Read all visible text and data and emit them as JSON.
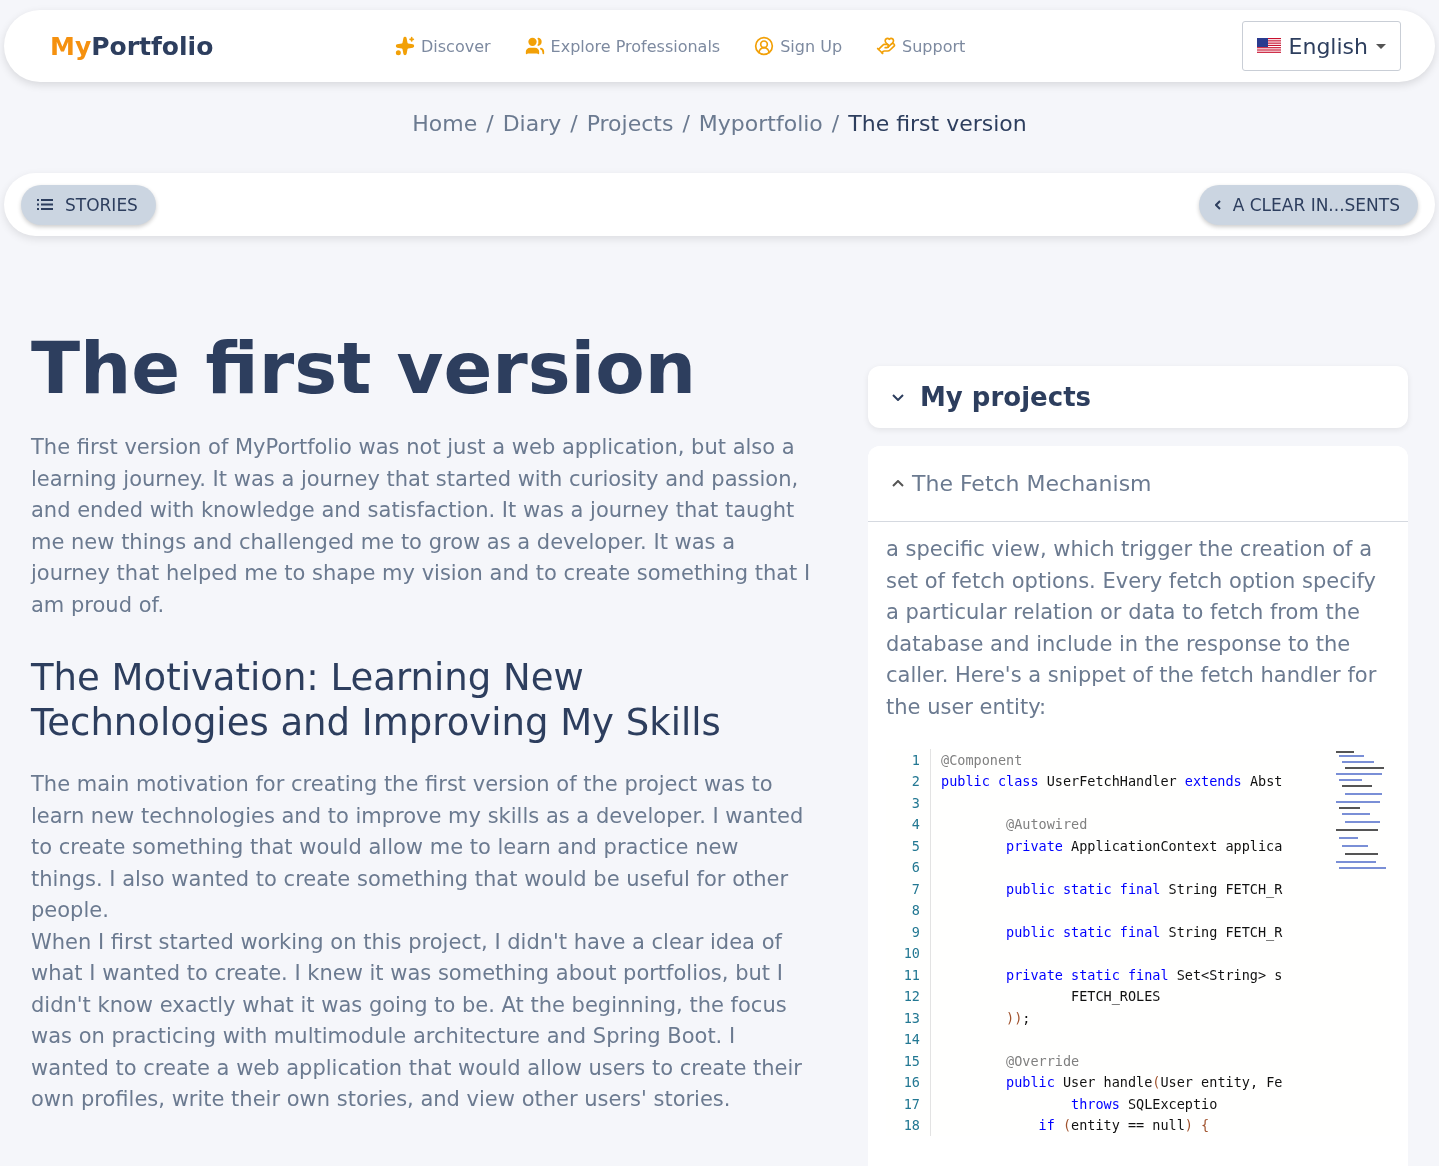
{
  "header": {
    "logo": {
      "accent": "My",
      "rest": "Portfolio"
    },
    "nav": [
      {
        "label": "Discover"
      },
      {
        "label": "Explore Professionals"
      },
      {
        "label": "Sign Up"
      },
      {
        "label": "Support"
      }
    ],
    "language": {
      "label": "English"
    }
  },
  "breadcrumbs": [
    {
      "label": "Home",
      "current": false
    },
    {
      "separator": "/",
      "label": "Diary",
      "current": false
    },
    {
      "separator": "/",
      "label": "Projects",
      "current": false
    },
    {
      "separator": "/",
      "label": "Myportfolio",
      "current": false
    },
    {
      "separator": "/",
      "label": "The first version",
      "current": true
    }
  ],
  "story_bar": {
    "stories_button": "STORIES",
    "previous_button": "A CLEAR IN...SENTS"
  },
  "article": {
    "title": "The first version",
    "intro": "The first version of MyPortfolio was not just a web application, but also a learning journey. It was a journey that started with curiosity and passion, and ended with knowledge and satisfaction. It was a journey that taught me new things and challenged me to grow as a developer. It was a journey that helped me to shape my vision and to create something that I am proud of.",
    "section_heading": "The Motivation: Learning New Technologies and Improving My Skills",
    "paragraphs": [
      "The main motivation for creating the first version of the project was to learn new technologies and to improve my skills as a developer. I wanted to create something that would allow me to learn and practice new things. I also wanted to create something that would be useful for other people.",
      "When I first started working on this project, I didn't have a clear idea of what I wanted to create. I knew it was something about portfolios, but I didn't know exactly what it was going to be. At the beginning, the focus was on practicing with multimodule architecture and Spring Boot. I wanted to create a web application that would allow users to create their own profiles, write their own stories, and view other users' stories."
    ]
  },
  "sidebar": {
    "projects": {
      "title": "My projects",
      "expanded": false
    },
    "section": {
      "title": "The Fetch Mechanism",
      "expanded": true,
      "text": "a specific view, which trigger the creation of a set of fetch options. Every fetch option specify a particular relation or data to fetch from the database and include in the response to the caller. Here's a snippet of the fetch handler for the user entity:",
      "code": [
        {
          "number": "1",
          "tokens": [
            {
              "kind": "annotation",
              "text": "@Component"
            }
          ]
        },
        {
          "number": "2",
          "tokens": [
            {
              "kind": "keyword",
              "text": "public class"
            },
            {
              "kind": "plain",
              "text": " UserFetchHandler"
            },
            {
              "kind": "keyword",
              "text": " extends"
            },
            {
              "kind": "plain",
              "text": " Abst"
            }
          ]
        },
        {
          "number": "3"
        },
        {
          "number": "4",
          "tokens": [
            {
              "kind": "annotation",
              "text": "        @Autowired"
            }
          ]
        },
        {
          "number": "5",
          "tokens": [
            {
              "kind": "keyword",
              "text": "        private"
            },
            {
              "kind": "plain",
              "text": " ApplicationContext applica"
            }
          ]
        },
        {
          "number": "6"
        },
        {
          "number": "7",
          "tokens": [
            {
              "kind": "keyword",
              "text": "        public static final"
            },
            {
              "kind": "plain",
              "text": " String FETCH_R"
            }
          ]
        },
        {
          "number": "8"
        },
        {
          "number": "9",
          "tokens": [
            {
              "kind": "keyword",
              "text": "        public static final"
            },
            {
              "kind": "plain",
              "text": " String FETCH_R"
            }
          ]
        },
        {
          "number": "10"
        },
        {
          "number": "11",
          "tokens": [
            {
              "kind": "keyword",
              "text": "        private static final"
            },
            {
              "kind": "plain",
              "text": " Set<String> s"
            }
          ]
        },
        {
          "number": "12",
          "tokens": [
            {
              "kind": "plain",
              "text": "                FETCH_ROLES"
            }
          ]
        },
        {
          "number": "13",
          "tokens": [
            {
              "kind": "bracket",
              "text": "        ))"
            },
            {
              "kind": "plain",
              "text": ";"
            }
          ]
        },
        {
          "number": "14"
        },
        {
          "number": "15",
          "tokens": [
            {
              "kind": "annotation",
              "text": "        @Override"
            }
          ]
        },
        {
          "number": "16",
          "tokens": [
            {
              "kind": "keyword",
              "text": "        public"
            },
            {
              "kind": "plain",
              "text": " User handle"
            },
            {
              "kind": "bracket",
              "text": "("
            },
            {
              "kind": "plain",
              "text": "User entity, Fe"
            }
          ]
        },
        {
          "number": "17",
          "tokens": [
            {
              "kind": "keyword",
              "text": "                throws"
            },
            {
              "kind": "plain",
              "text": " SQLExceptio"
            }
          ]
        },
        {
          "number": "18",
          "tokens": [
            {
              "kind": "keyword",
              "text": "            if"
            },
            {
              "kind": "bracket",
              "text": " ("
            },
            {
              "kind": "plain",
              "text": "entity == null"
            },
            {
              "kind": "bracket",
              "text": ") {"
            }
          ]
        }
      ]
    }
  }
}
